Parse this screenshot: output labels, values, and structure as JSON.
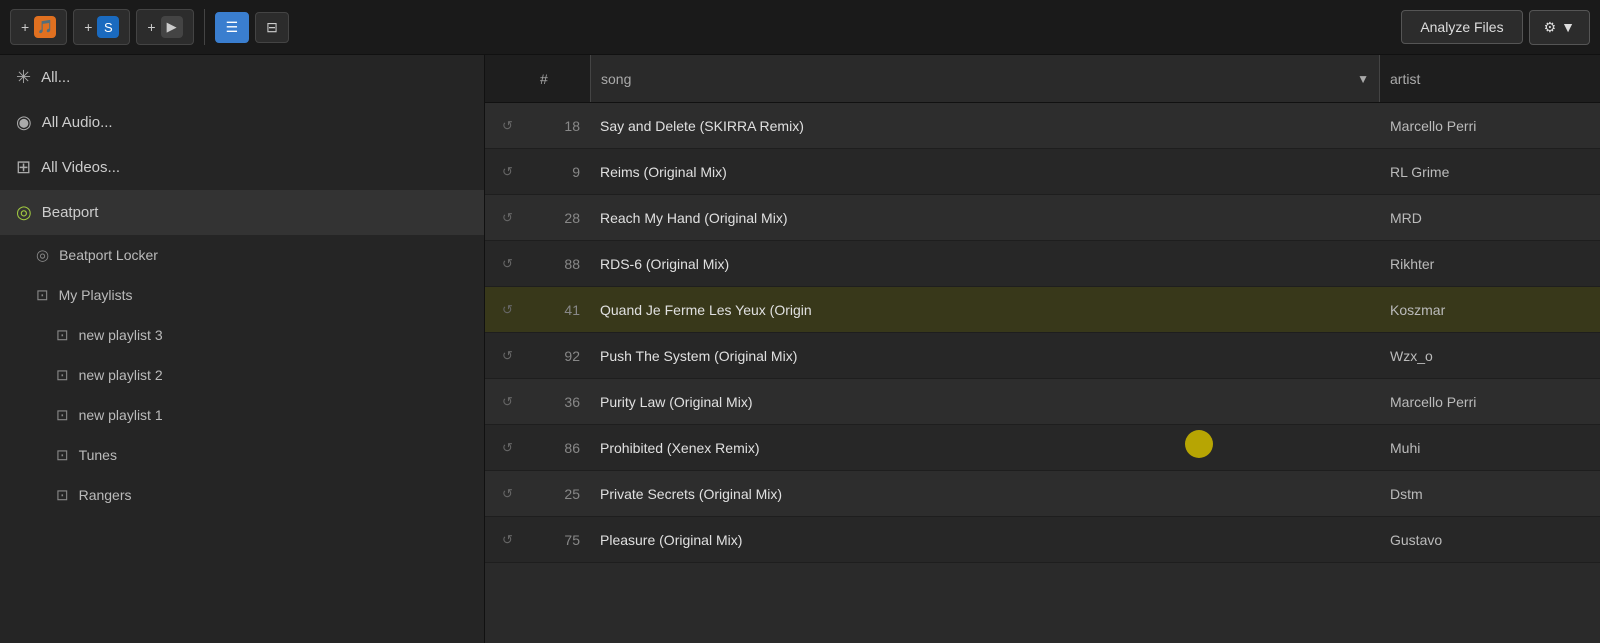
{
  "toolbar": {
    "add_track_label": "+",
    "add_playlist_label": "+",
    "add_video_label": "+",
    "view_list_label": "≡",
    "view_detail_label": "⊟",
    "analyze_files_label": "Analyze Files",
    "gear_label": "⚙",
    "dropdown_arrow": "▼"
  },
  "sidebar": {
    "items": [
      {
        "id": "all",
        "label": "All...",
        "icon": "✳"
      },
      {
        "id": "all-audio",
        "label": "All Audio...",
        "icon": "◉"
      },
      {
        "id": "all-videos",
        "label": "All Videos...",
        "icon": "⊞"
      },
      {
        "id": "beatport",
        "label": "Beatport",
        "icon": "◎",
        "icon_color": "green",
        "active": true
      },
      {
        "id": "beatport-locker",
        "label": "Beatport Locker",
        "icon": "◎",
        "indent": true
      },
      {
        "id": "my-playlists",
        "label": "My Playlists",
        "icon": "⊡",
        "indent": true
      },
      {
        "id": "playlist-3",
        "label": "new playlist 3",
        "icon": "⊡",
        "indent2": true
      },
      {
        "id": "playlist-2",
        "label": "new playlist 2",
        "icon": "⊡",
        "indent2": true
      },
      {
        "id": "playlist-1",
        "label": "new playlist 1",
        "icon": "⊡",
        "indent2": true
      },
      {
        "id": "tunes",
        "label": "Tunes",
        "icon": "⊡",
        "indent2": true
      },
      {
        "id": "rangers",
        "label": "Rangers",
        "icon": "⊡",
        "indent2": true
      }
    ]
  },
  "table": {
    "columns": {
      "play": "",
      "number": "#",
      "song": "song",
      "artist": "artist"
    },
    "rows": [
      {
        "play": "↺",
        "number": "18",
        "song": "Say and Delete (SKIRRA Remix)",
        "artist": "Marcello Perri",
        "highlighted": false
      },
      {
        "play": "↺",
        "number": "9",
        "song": "Reims (Original Mix)",
        "artist": "RL Grime",
        "highlighted": false
      },
      {
        "play": "↺",
        "number": "28",
        "song": "Reach My Hand (Original Mix)",
        "artist": "MRD",
        "highlighted": false
      },
      {
        "play": "↺",
        "number": "88",
        "song": "RDS-6 (Original Mix)",
        "artist": "Rikhter",
        "highlighted": false
      },
      {
        "play": "↺",
        "number": "41",
        "song": "Quand Je Ferme Les Yeux (Origin",
        "artist": "Koszmar",
        "highlighted": true
      },
      {
        "play": "↺",
        "number": "92",
        "song": "Push The System (Original Mix)",
        "artist": "Wzx_o",
        "highlighted": false
      },
      {
        "play": "↺",
        "number": "36",
        "song": "Purity Law (Original Mix)",
        "artist": "Marcello Perri",
        "highlighted": false
      },
      {
        "play": "↺",
        "number": "86",
        "song": "Prohibited (Xenex Remix)",
        "artist": "Muhi",
        "highlighted": false
      },
      {
        "play": "↺",
        "number": "25",
        "song": "Private Secrets (Original Mix)",
        "artist": "Dstm",
        "highlighted": false
      },
      {
        "play": "↺",
        "number": "75",
        "song": "Pleasure (Original Mix)",
        "artist": "Gustavo",
        "highlighted": false
      }
    ]
  }
}
